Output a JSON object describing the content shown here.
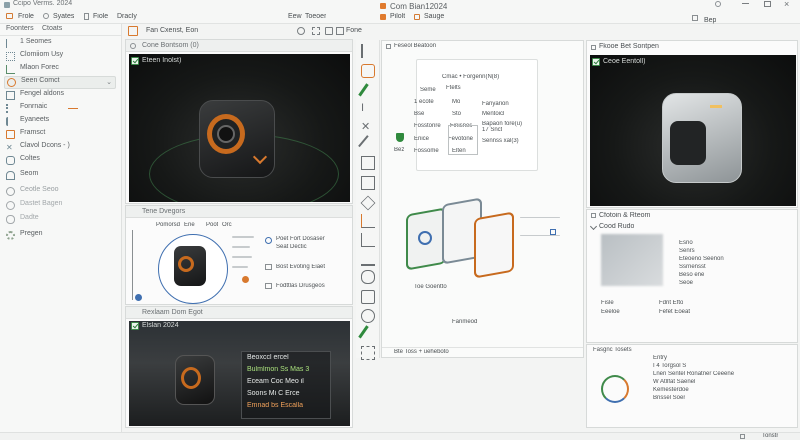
{
  "window": {
    "title": "Ccipo Verms. 2024",
    "center_title": "Com Bian12024",
    "center_menu": [
      "Pilolt",
      "Sauge"
    ],
    "right_label": "Bep"
  },
  "menubar": {
    "items": [
      "Frole",
      "Syates",
      "Fiole",
      "Dracly"
    ],
    "center_items": [
      "Eew",
      "Toeoer"
    ]
  },
  "toolbar": {
    "left_btn": "Fan Cxenst, Eon",
    "right_btn": "Fone"
  },
  "sidebar": {
    "tabs": [
      "Foonters",
      "Ctoats"
    ],
    "items": [
      {
        "label": "1 Seomes",
        "icon": "list-icon"
      },
      {
        "label": "Clomiiom Usy",
        "icon": "grid-icon"
      },
      {
        "label": "Mlaon Forec",
        "icon": "branch-icon"
      },
      {
        "label": "Seen Comct",
        "icon": "search-icon",
        "selected": true
      },
      {
        "label": "Fengel aldons",
        "icon": "layout-icon"
      },
      {
        "label": "Fonrnaic",
        "icon": "dots-icon"
      },
      {
        "label": "Eyaneets",
        "icon": "brush-icon"
      },
      {
        "label": "Framsct",
        "icon": "folder-icon"
      },
      {
        "label": "Clavol Dcons  - )",
        "icon": "cross-icon"
      },
      {
        "label": "Coltes",
        "icon": "chat-icon"
      },
      {
        "label": "Seom",
        "icon": "home-icon"
      },
      {
        "label": "Ceotle Seoo",
        "icon": "user-icon"
      },
      {
        "label": "Dastet Bagen",
        "icon": "search-icon"
      },
      {
        "label": "Dadte",
        "icon": "cloud-icon"
      },
      {
        "label": "Pregen",
        "icon": "gear-icon"
      }
    ]
  },
  "panels": {
    "viewport_a": {
      "title": "Cone Bontsom (0)",
      "caption": "Eteen Inolst)"
    },
    "details": {
      "title": "Tene Dvegors",
      "headers": [
        "Pomorsd",
        "Ene",
        "Poot",
        "Orc"
      ],
      "options": [
        "Poet Fort Dosaser",
        "Seat Dectic",
        "Bost Evoting Eiaet",
        "Fodttlas Drusgeos"
      ]
    },
    "render": {
      "title": "Rexlaam Dom Egot",
      "caption": "Elslan 2024",
      "overlay": [
        "Beoxccl ercel",
        "Bulmlmon  Ss Mas 3",
        "Eceam Coc Meo il",
        "Soons Mi C Erce",
        "Emnad bs Escalla"
      ]
    },
    "center": {
      "title": "Feseol Beatoon",
      "node_lines": [
        "Cmac • Forgenn(N(8)",
        "Ftelts",
        "Fanyarion",
        "Mentoicl",
        "Bapaon fore(u)"
      ],
      "rows": [
        {
          "label": "Seme",
          "value": ""
        },
        {
          "label": "1 ecote",
          "value": "Mo"
        },
        {
          "label": "Bse",
          "value": "Sto"
        },
        {
          "label": "Fosstonre",
          "value": "Finisnes"
        },
        {
          "label": "Enice",
          "value": "Fevotone"
        },
        {
          "label": "Fossome",
          "value": "Elten"
        }
      ],
      "row_values2": [
        "17 Snct",
        "Sennss xal(3)"
      ],
      "mid_label": "Bez",
      "caption_left": "Toe Goentto",
      "caption_right": "Fanmeod",
      "footer": "Bte  Toss + ueheboto"
    },
    "viewport_b": {
      "title": "Fkooe Bet Sontpen",
      "caption": "Ceoe Eentoll)"
    },
    "props": {
      "title": "Cfotoin & Rteom",
      "subtitle": "Cood Rudo",
      "lines": [
        "Esno",
        "Senrs",
        "Eteoeno Seenon",
        "Ssrnensst",
        "Beso ene",
        "Seoe"
      ],
      "rows": [
        [
          "Fisle",
          "Fdrit Efto"
        ],
        [
          "Eeeloe",
          "Fefet Eoeat"
        ]
      ]
    },
    "footer_panel": {
      "title": "Fasgnc Tosets",
      "lines": [
        "Entry",
        "I 4 Torgsol S",
        "Lnen Sentel Ronatner Ceeene",
        "W Atllfat Saenel",
        "Kemesterdoe",
        "Bnssel Soer"
      ]
    }
  },
  "statusbar": {
    "left": "",
    "right": "Tonstr"
  }
}
